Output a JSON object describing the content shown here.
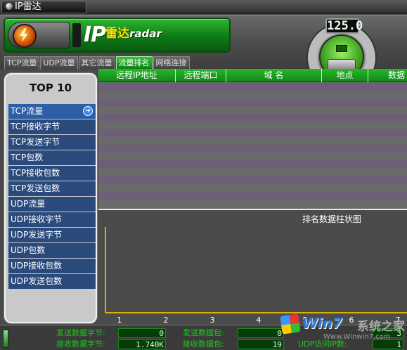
{
  "window": {
    "title": "IP雷达"
  },
  "logo": {
    "ip": "IP",
    "cn": "雷达",
    "en": "radar"
  },
  "tabs": [
    {
      "label": "TCP流量",
      "active": false
    },
    {
      "label": "UDP流量",
      "active": false
    },
    {
      "label": "其它流量",
      "active": false
    },
    {
      "label": "流量排名",
      "active": true
    },
    {
      "label": "网络连接",
      "active": false
    }
  ],
  "gauge": {
    "display": "125.0",
    "led": "BI"
  },
  "left_panel": {
    "title": "TOP 10",
    "items": [
      {
        "label": "TCP流量",
        "selected": true
      },
      {
        "label": "TCP接收字节",
        "selected": false
      },
      {
        "label": "TCP发送字节",
        "selected": false
      },
      {
        "label": "TCP包数",
        "selected": false
      },
      {
        "label": "TCP接收包数",
        "selected": false
      },
      {
        "label": "TCP发送包数",
        "selected": false
      },
      {
        "label": "UDP流量",
        "selected": false
      },
      {
        "label": "UDP接收字节",
        "selected": false
      },
      {
        "label": "UDP发送字节",
        "selected": false
      },
      {
        "label": "UDP包数",
        "selected": false
      },
      {
        "label": "UDP接收包数",
        "selected": false
      },
      {
        "label": "UDP发送包数",
        "selected": false
      }
    ]
  },
  "table": {
    "columns": [
      "远程IP地址",
      "远程端口",
      "域 名",
      "地点",
      "数据"
    ]
  },
  "chart": {
    "title": "排名数据柱状图",
    "x_ticks": [
      "1",
      "2",
      "3",
      "4",
      "5",
      "6",
      "7"
    ]
  },
  "status": {
    "send_bytes_label": "发送数据字节:",
    "send_bytes_value": "0",
    "recv_bytes_label": "接收数据字节:",
    "recv_bytes_value": "1.740K",
    "send_packets_label": "发送数据包:",
    "send_packets_value": "0",
    "recv_packets_label": "接收数据包:",
    "recv_packets_value": "19",
    "udp_ip_label": "UDP访问IP数:",
    "udp_ip_value": "1",
    "other_value": "3"
  },
  "watermark": {
    "brand": "Win7",
    "cn": "系统之家",
    "url": "Www.Winwin7.com"
  },
  "colors": {
    "accent_green": "#0c8a16",
    "list_blue": "#2a4a7c",
    "chart_axis": "#d4b300",
    "status_green": "#1fc81f"
  }
}
